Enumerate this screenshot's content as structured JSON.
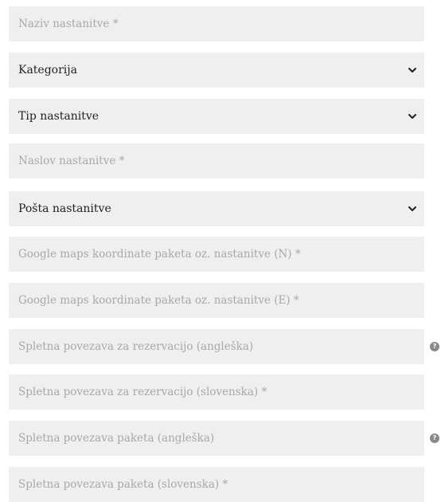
{
  "form": {
    "fields": [
      {
        "kind": "input",
        "placeholder": "Naziv nastanitve *"
      },
      {
        "kind": "select",
        "value": "Kategorija",
        "icon": "chevron-down-icon"
      },
      {
        "kind": "select",
        "value": "Tip nastanitve",
        "icon": "chevron-down-icon"
      },
      {
        "kind": "input",
        "placeholder": "Naslov nastanitve *"
      },
      {
        "kind": "select",
        "value": "Pošta nastanitve",
        "icon": "chevron-down-icon"
      },
      {
        "kind": "input",
        "placeholder": "Google maps koordinate paketa oz. nastanitve (N) *"
      },
      {
        "kind": "input",
        "placeholder": "Google maps koordinate paketa oz. nastanitve (E) *"
      },
      {
        "kind": "input",
        "placeholder": "Spletna povezava za rezervacijo (angleška)",
        "help_icon": "question-icon",
        "help_glyph": "?"
      },
      {
        "kind": "input",
        "placeholder": "Spletna povezava za rezervacijo (slovenska) *"
      },
      {
        "kind": "input",
        "placeholder": "Spletna povezava paketa (angleška)",
        "help_icon": "question-icon",
        "help_glyph": "?"
      },
      {
        "kind": "input",
        "placeholder": "Spletna povezava paketa (slovenska) *"
      }
    ]
  },
  "colors": {
    "field_background": "#efefef",
    "placeholder_text": "#a8a8a8",
    "select_text": "#1f1f1f",
    "help_icon": "#8a8a8a"
  }
}
